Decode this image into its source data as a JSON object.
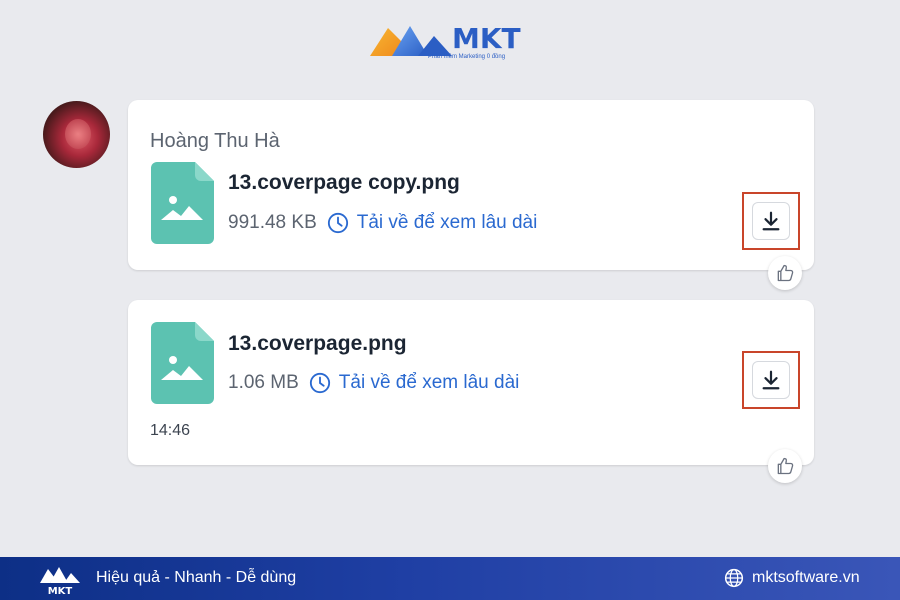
{
  "brand": {
    "logo_text": "MKT",
    "logo_tagline": "Phần mềm Marketing 0 đồng"
  },
  "chat": {
    "sender_name": "Hoàng Thu Hà",
    "messages": [
      {
        "file_name": "13.coverpage copy.png",
        "file_size": "991.48 KB",
        "download_label": "Tải về để xem lâu dài"
      },
      {
        "file_name": "13.coverpage.png",
        "file_size": "1.06 MB",
        "download_label": "Tải về để xem lâu dài",
        "time": "14:46"
      }
    ]
  },
  "footer": {
    "logo_text": "MKT",
    "slogan": "Hiệu quả - Nhanh - Dễ dùng",
    "website": "mktsoftware.vn"
  },
  "colors": {
    "accent": "#2a69d0",
    "highlight_border": "#c9452a",
    "file_icon": "#5cc2b1",
    "footer_bg": "#1f3fa4"
  }
}
